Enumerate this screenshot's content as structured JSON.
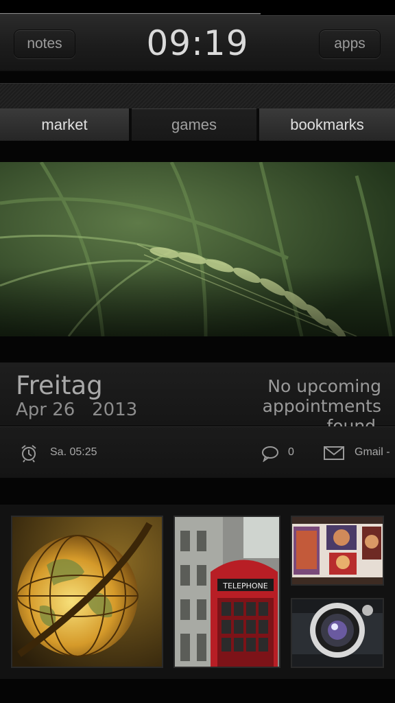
{
  "top_bar": {
    "notes_label": "notes",
    "clock": "09:19",
    "apps_label": "apps"
  },
  "status": {
    "progress": 0.66
  },
  "tabs": [
    {
      "label": "market"
    },
    {
      "label": "games"
    },
    {
      "label": "bookmarks"
    }
  ],
  "wallpaper": {
    "icon": "wheat-photo"
  },
  "date": {
    "day": "Freitag",
    "date_line": "Apr 26   2013",
    "appointments": "No upcoming appointments found."
  },
  "info": {
    "alarm_icon": "alarm-clock-icon",
    "alarm": "Sa. 05:25",
    "sms_icon": "speech-bubble-icon",
    "sms_count": "0",
    "mail_icon": "envelope-icon",
    "mail_label": "Gmail -"
  },
  "photos": [
    {
      "icon": "globe-photo"
    },
    {
      "icon": "telephone-booth-photo"
    },
    {
      "icon": "art-gallery-photo"
    },
    {
      "icon": "camera-lens-photo"
    }
  ],
  "photo_texts": {
    "booth_sign": "TELEPHONE"
  },
  "colors": {
    "background": "#050505",
    "text": "#cfcfcf",
    "booth_red": "#b81e25",
    "grass_green": "#3b5530"
  }
}
